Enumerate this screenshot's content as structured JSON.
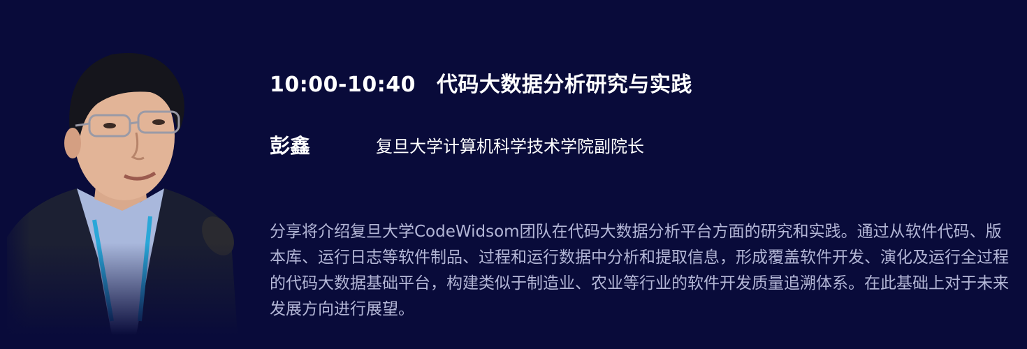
{
  "session": {
    "time": "10:00-10:40",
    "title": "代码大数据分析研究与实践"
  },
  "speaker": {
    "name": "彭鑫",
    "role": "复旦大学计算机科学技术学院副院长",
    "photo_icon": "speaker-portrait"
  },
  "abstract": "分享将介绍复旦大学CodeWidsom团队在代码大数据分析平台方面的研究和实践。通过从软件代码、版本库、运行日志等软件制品、过程和运行数据中分析和提取信息，形成覆盖软件开发、演化及运行全过程的代码大数据基础平台，构建类似于制造业、农业等行业的软件开发质量追溯体系。在此基础上对于未来发展方向进行展望。",
  "colors": {
    "background": "#090b3a",
    "title_text": "#ffffff",
    "abstract_text": "#b3b6d6"
  }
}
